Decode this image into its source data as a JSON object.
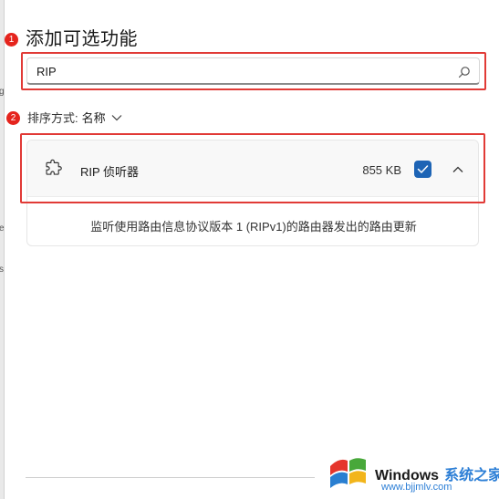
{
  "markers": [
    "1",
    "2"
  ],
  "dialog": {
    "title": "添加可选功能"
  },
  "search": {
    "value": "RIP"
  },
  "sort": {
    "label": "排序方式:",
    "value": "名称"
  },
  "feature": {
    "icon": "puzzle-icon",
    "name": "RIP 侦听器",
    "size": "855 KB",
    "checked": true,
    "expanded": true,
    "description": "监听使用路由信息协议版本 1 (RIPv1)的路由器发出的路由更新"
  },
  "colors": {
    "accent": "#1d64b5",
    "highlight": "#e13a36",
    "marker": "#e5241d"
  },
  "watermark": {
    "brand": "Windows",
    "cn": "系统之家",
    "url": "www.bjjmlv.com"
  },
  "left_strip": [
    "g",
    "e",
    "s"
  ]
}
